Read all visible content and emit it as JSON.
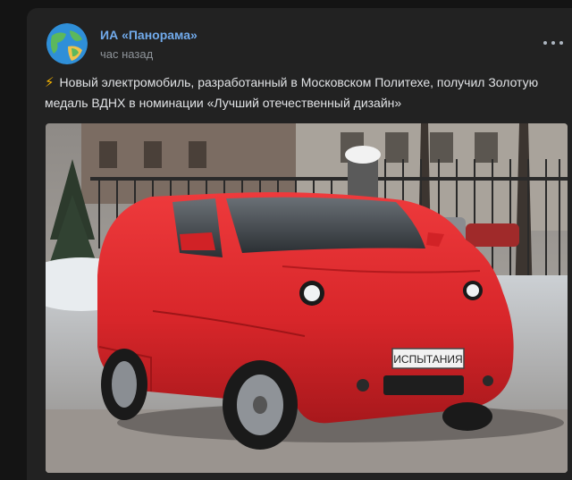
{
  "post": {
    "author": "ИА «Панорама»",
    "time": "час назад",
    "emoji": "⚡",
    "text": "Новый электромобиль, разработанный в Московском Политехе, получил Золотую медаль ВДНХ в номинации «Лучший отечественный дизайн»",
    "plate": "ИСПЫТАНИЯ",
    "icons": {
      "avatar": "globe-icon",
      "menu": "more-horizontal-icon"
    }
  },
  "colors": {
    "accent": "#71aaeb",
    "background": "#141414",
    "card": "#222222",
    "car": "#d8262a"
  }
}
